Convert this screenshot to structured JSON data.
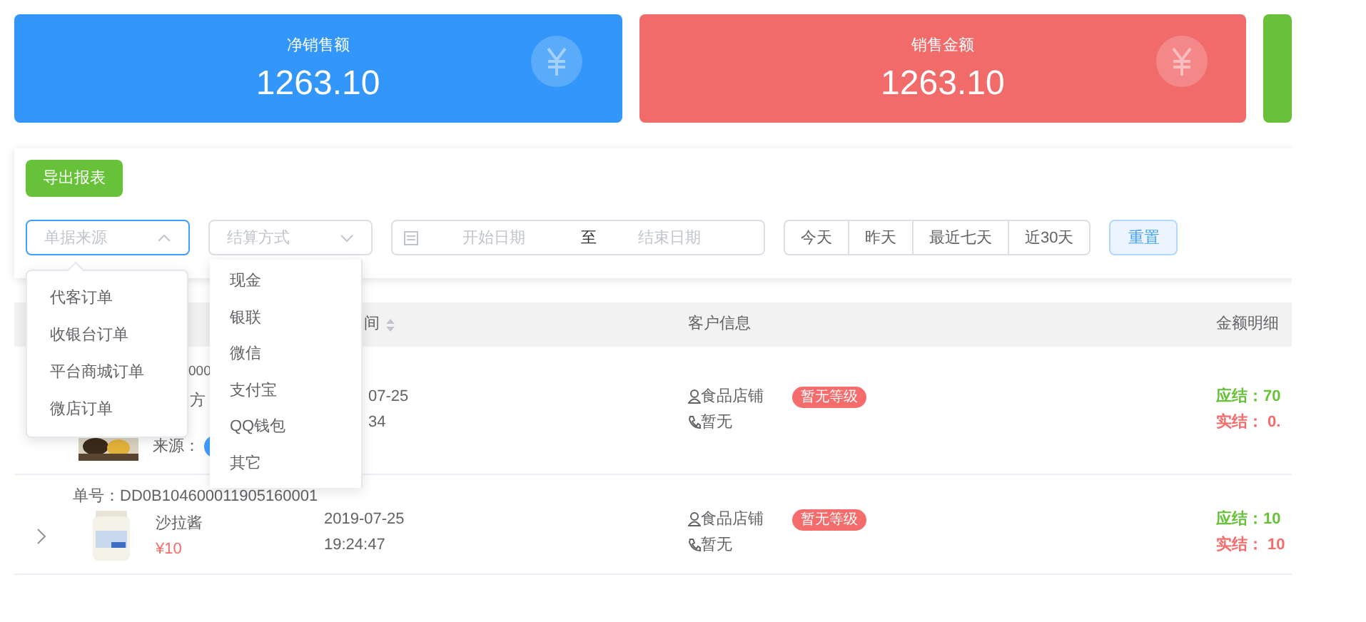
{
  "cards": [
    {
      "title": "净销售额",
      "value": "1263.10",
      "color": "#3296fa"
    },
    {
      "title": "销售金额",
      "value": "1263.10",
      "color": "#f26b6b"
    },
    {
      "color": "#67c23a"
    }
  ],
  "toolbar": {
    "export_button": "导出报表",
    "selects": [
      {
        "placeholder": "单据来源",
        "expanded": true
      },
      {
        "placeholder": "结算方式",
        "expanded": false
      }
    ],
    "date_range": {
      "start_placeholder": "开始日期",
      "separator": "至",
      "end_placeholder": "结束日期"
    },
    "quick_ranges": [
      "今天",
      "昨天",
      "最近七天",
      "近30天"
    ],
    "reset_button": "重置"
  },
  "source_menu": [
    "代客订单",
    "收银台订单",
    "平台商城订单",
    "微店订单"
  ],
  "payment_menu": [
    "现金",
    "银联",
    "微信",
    "支付宝",
    "QQ钱包",
    "其它"
  ],
  "table": {
    "columns": [
      {
        "label": "间",
        "sortable": true
      },
      {
        "label": "客户信息",
        "sortable": false
      },
      {
        "label": "金额明细",
        "sortable": false
      }
    ],
    "rows": [
      {
        "kind": "covered",
        "order_no": "000",
        "product_name": "方",
        "source_label": "来源：",
        "date": "07-25",
        "time": "34",
        "customer": "食品店铺",
        "level_badge": "暂无等级",
        "phone": "暂无",
        "payable": "应结：70",
        "paid": "实结： 0."
      },
      {
        "kind": "full",
        "order_no": "单号：DD0B104600011905160001",
        "product_name": "沙拉酱",
        "price": "¥10",
        "date": "2019-07-25",
        "time": "19:24:47",
        "customer": "食品店铺",
        "level_badge": "暂无等级",
        "phone": "暂无",
        "payable": "应结：10",
        "paid": "实结： 10"
      }
    ]
  }
}
